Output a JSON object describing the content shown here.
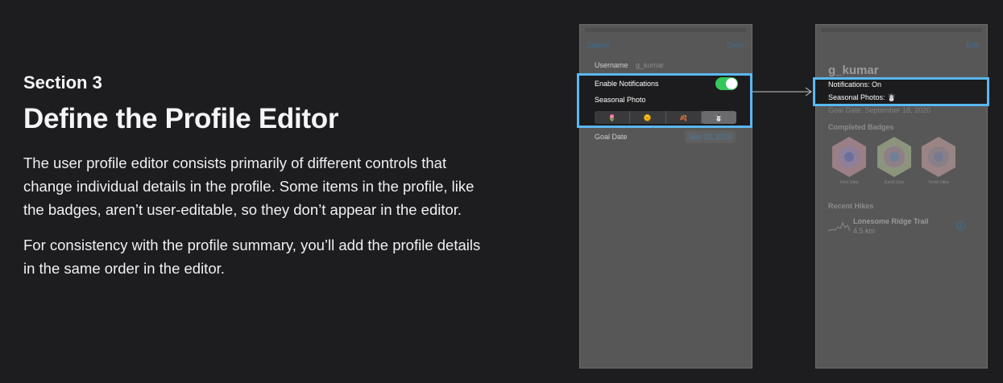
{
  "left": {
    "section_label": "Section 3",
    "title": "Define the Profile Editor",
    "paragraph1": "The user profile editor consists primarily of different controls that change individual details in the profile. Some items in the profile, like the badges, aren’t user-editable, so they don’t appear in the editor.",
    "paragraph2": "For consistency with the profile summary, you’ll add the profile details in the same order in the editor."
  },
  "editor": {
    "cancel": "Cancel",
    "done": "Done",
    "username_label": "Username",
    "username_value": "g_kumar",
    "notifications_label": "Enable Notifications",
    "notifications_on": true,
    "seasonal_label": "Seasonal Photo",
    "seasons": [
      {
        "glyph": "🌷",
        "icon": "tulip-icon"
      },
      {
        "glyph": "🌞",
        "icon": "sun-icon"
      },
      {
        "glyph": "🍂",
        "icon": "leaf-icon"
      },
      {
        "glyph": "☃️",
        "icon": "snowman-icon"
      }
    ],
    "selected_season": 3,
    "goal_label": "Goal Date",
    "goal_value": "Sep 18, 2020"
  },
  "summary": {
    "edit": "Edit",
    "username": "g_kumar",
    "notifications": "Notifications: On",
    "seasonal": "Seasonal Photos: ☃️",
    "goal": "Goal Date: September 18, 2020",
    "badges_heading": "Completed Badges",
    "badges": [
      "First Hike",
      "Earth Day",
      "Tenth Hike"
    ],
    "recent_heading": "Recent Hikes",
    "hike_name": "Lonesome Ridge Trail",
    "hike_distance": "4.5 km"
  },
  "colors": {
    "highlight": "#5bb7f2",
    "toggle_on": "#34c759",
    "accent_dim": "#3f6e93"
  }
}
